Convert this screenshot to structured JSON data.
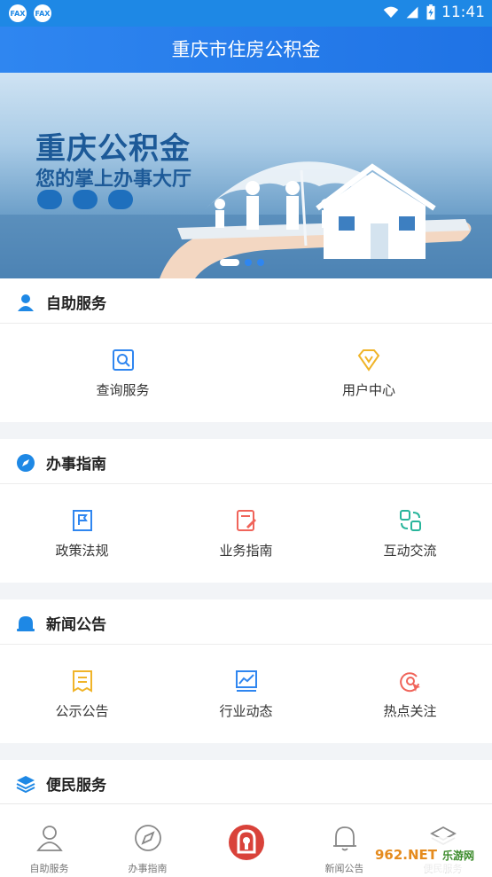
{
  "status_bar": {
    "time": "11:41",
    "notifications": [
      "fax-app-icon",
      "fax-app-icon"
    ],
    "icons": [
      "wifi-icon",
      "signal-icon",
      "battery-charging-icon"
    ]
  },
  "header": {
    "title": "重庆市住房公积金"
  },
  "banner": {
    "title": "重庆公积金",
    "subtitle": "您的掌上办事大厅",
    "platform_icons": [
      "wechat-icon",
      "app-store-icon",
      "computer-icon"
    ],
    "slides": 3,
    "active_slide": 1
  },
  "sections": [
    {
      "title": "自助服务",
      "icon": "person-icon",
      "items": [
        {
          "label": "查询服务",
          "icon": "search-doc-icon",
          "color": "#2f86f0"
        },
        {
          "label": "用户中心",
          "icon": "diamond-icon",
          "color": "#f0b429"
        }
      ]
    },
    {
      "title": "办事指南",
      "icon": "compass-icon",
      "items": [
        {
          "label": "政策法规",
          "icon": "flag-doc-icon",
          "color": "#2f86f0"
        },
        {
          "label": "业务指南",
          "icon": "edit-doc-icon",
          "color": "#f0645a"
        },
        {
          "label": "互动交流",
          "icon": "exchange-icon",
          "color": "#28b59b"
        }
      ]
    },
    {
      "title": "新闻公告",
      "icon": "bell-icon",
      "items": [
        {
          "label": "公示公告",
          "icon": "notice-icon",
          "color": "#f0b429"
        },
        {
          "label": "行业动态",
          "icon": "trend-chart-icon",
          "color": "#2f86f0"
        },
        {
          "label": "热点关注",
          "icon": "hotspot-icon",
          "color": "#f0645a"
        }
      ]
    },
    {
      "title": "便民服务",
      "icon": "layers-icon",
      "items": []
    }
  ],
  "tabbar": [
    {
      "label": "自助服务",
      "icon": "person-outline-icon"
    },
    {
      "label": "办事指南",
      "icon": "compass-outline-icon"
    },
    {
      "label": "",
      "icon": "home-center-icon",
      "color": "#d9423a"
    },
    {
      "label": "新闻公告",
      "icon": "bell-outline-icon"
    },
    {
      "label": "便民服务",
      "icon": "layers-outline-icon"
    }
  ],
  "watermark": {
    "text": "962.NET",
    "subtext": "乐游网"
  },
  "colors": {
    "primary": "#1e88e5",
    "header": "#2f86f0",
    "background": "#f2f4f7"
  }
}
